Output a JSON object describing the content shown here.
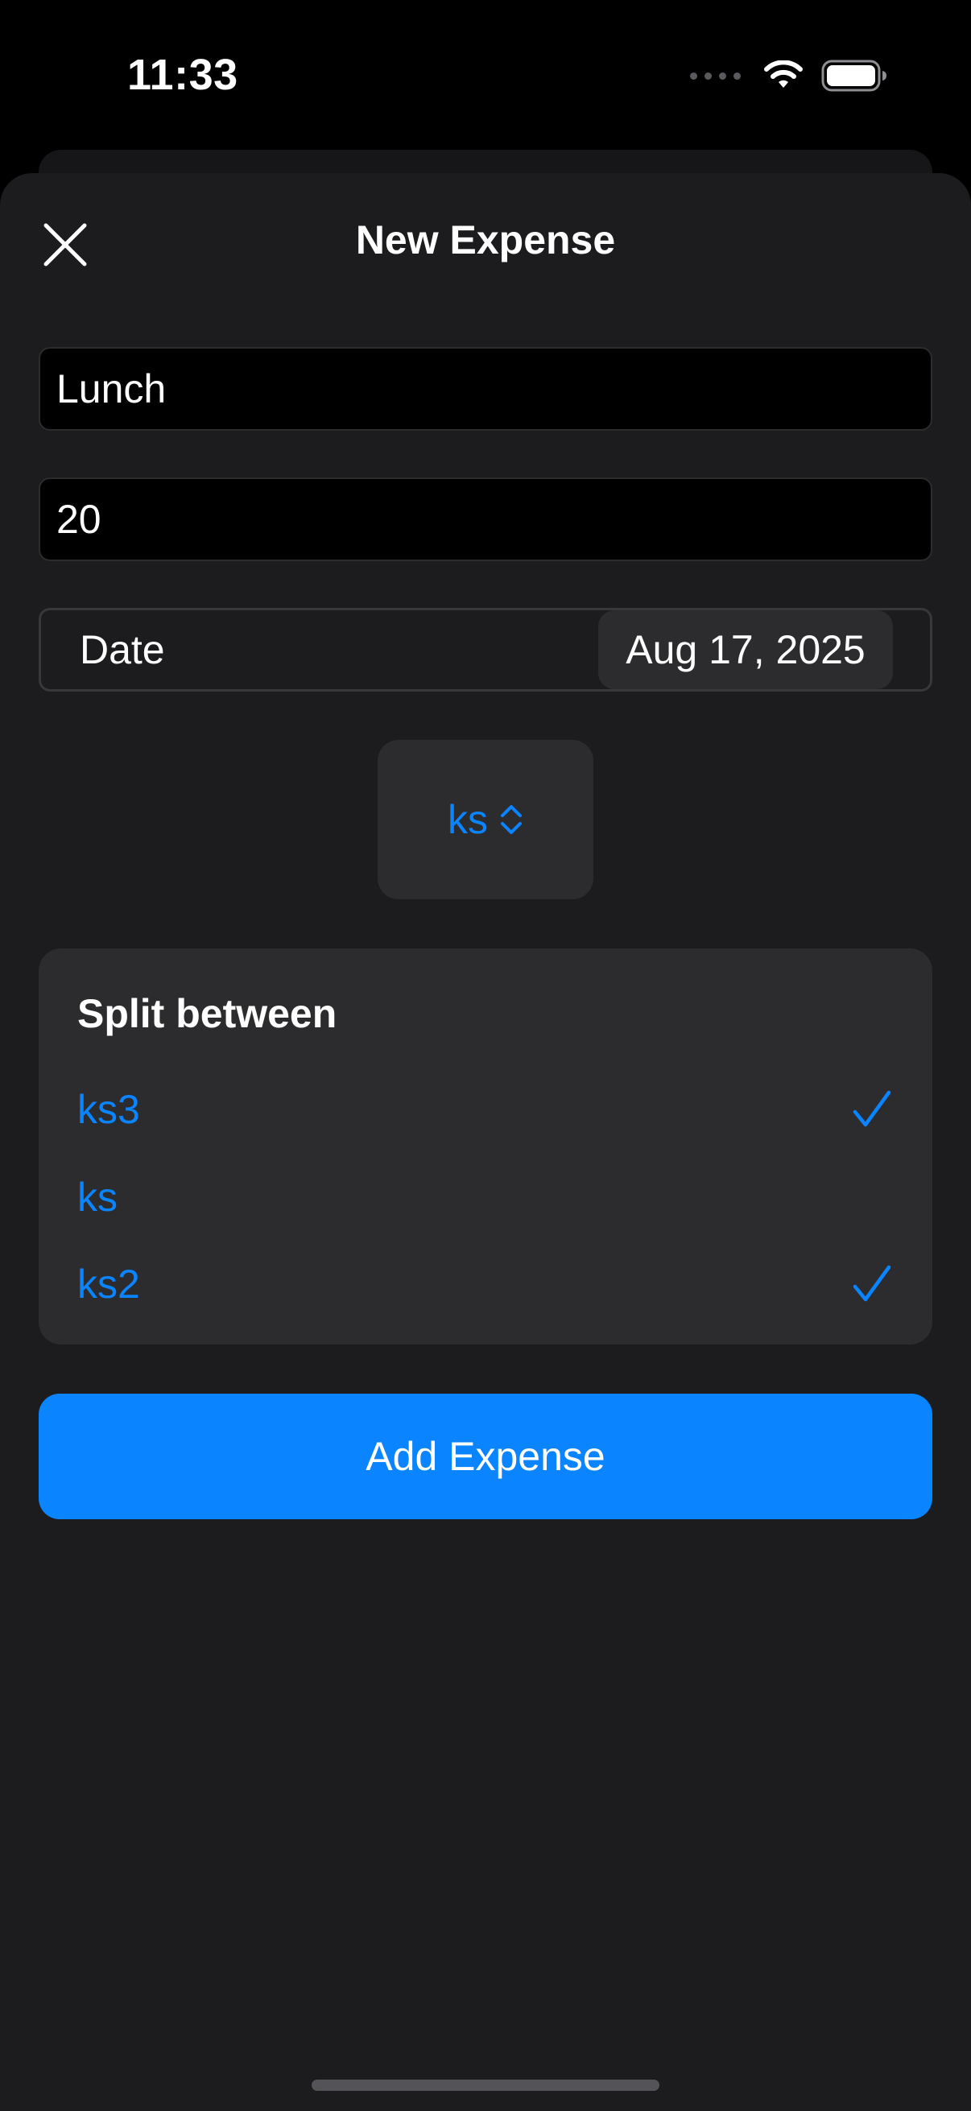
{
  "status_bar": {
    "time": "11:33"
  },
  "sheet": {
    "title": "New Expense",
    "close_icon": "close-icon"
  },
  "form": {
    "name_value": "Lunch",
    "amount_value": "20",
    "date_label": "Date",
    "date_value": "Aug 17, 2025",
    "payer_value": "ks"
  },
  "split": {
    "title": "Split between",
    "members": [
      {
        "name": "ks3",
        "selected": true
      },
      {
        "name": "ks",
        "selected": false
      },
      {
        "name": "ks2",
        "selected": true
      }
    ]
  },
  "actions": {
    "add_label": "Add Expense"
  },
  "colors": {
    "accent": "#0a84ff",
    "sheet_bg": "#1c1c1e",
    "card_bg": "#2c2c2e"
  }
}
